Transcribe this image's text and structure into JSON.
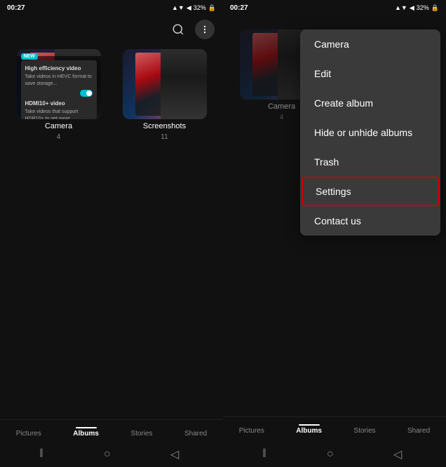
{
  "left_screen": {
    "status": {
      "time": "00:27",
      "battery": "32%",
      "signal": "▲▼",
      "battery_icon": "🔋"
    },
    "top_bar": {
      "search_icon": "search",
      "more_icon": "more-vertical"
    },
    "albums": [
      {
        "name": "Camera",
        "count": "4",
        "has_new_badge": true,
        "has_settings_overlay": true
      },
      {
        "name": "Screenshots",
        "count": "11",
        "has_new_badge": false,
        "has_settings_overlay": false
      }
    ],
    "settings_panel": {
      "line1": "High efficiency video",
      "line1_detail": "Take videos in HEVC format to save storage...",
      "toggle1": "on",
      "line2": "HDMI10+ video",
      "line2_detail": "Take videos that support HDR10+ to get more...",
      "toggle2": "off"
    },
    "bottom_nav": {
      "items": [
        "Pictures",
        "Albums",
        "Stories",
        "Shared"
      ],
      "active": "Albums"
    }
  },
  "right_screen": {
    "status": {
      "time": "00:27",
      "battery": "32%"
    },
    "albums": [
      {
        "name": "Camera",
        "count": "4"
      }
    ],
    "dropdown": {
      "items": [
        {
          "label": "Camera",
          "highlighted": false
        },
        {
          "label": "Edit",
          "highlighted": false
        },
        {
          "label": "Create album",
          "highlighted": false
        },
        {
          "label": "Hide or unhide albums",
          "highlighted": false
        },
        {
          "label": "Trash",
          "highlighted": false
        },
        {
          "label": "Settings",
          "highlighted": true
        },
        {
          "label": "Contact us",
          "highlighted": false
        }
      ]
    },
    "bottom_nav": {
      "items": [
        "Pictures",
        "Albums",
        "Stories",
        "Shared"
      ],
      "active": "Albums"
    }
  }
}
